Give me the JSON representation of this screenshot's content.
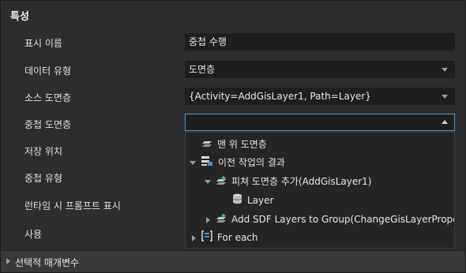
{
  "panel": {
    "title": "특성"
  },
  "properties": [
    {
      "label": "표시 이름",
      "value": "중첩 수행",
      "type": "text"
    },
    {
      "label": "데이터 유형",
      "value": "도면층",
      "type": "dropdown"
    },
    {
      "label": "소스 도면층",
      "value": "{Activity=AddGisLayer1, Path=Layer}",
      "type": "dropdown"
    },
    {
      "label": "중첩 도면층",
      "value": "",
      "type": "dropdown-open"
    },
    {
      "label": "저장 위치"
    },
    {
      "label": "중첩 유형"
    },
    {
      "label": "런타임 시 프롬프트 표시"
    },
    {
      "label": "사용"
    }
  ],
  "dropdown": {
    "items": [
      {
        "label": "맨 위 도면층",
        "icon": "layer-stack-icon"
      },
      {
        "label": "이전 작업의 결과",
        "icon": "previous-results-icon",
        "expanded": true
      },
      {
        "label": "피쳐 도면층 추가(AddGisLayer1)",
        "icon": "add-layer-icon",
        "expanded": true
      },
      {
        "label": "Layer",
        "icon": "database-icon"
      },
      {
        "label": "Add SDF Layers to Group(ChangeGisLayerProperties",
        "icon": "add-layer-icon",
        "expanded": false
      },
      {
        "label": "For each",
        "icon": "for-each-icon",
        "expanded": false
      }
    ]
  },
  "footer": {
    "label": "선택적 매개변수"
  },
  "colors": {
    "background": "#2d2d30",
    "field": "#1e1e1e",
    "focus_border": "#3f9ad6"
  }
}
